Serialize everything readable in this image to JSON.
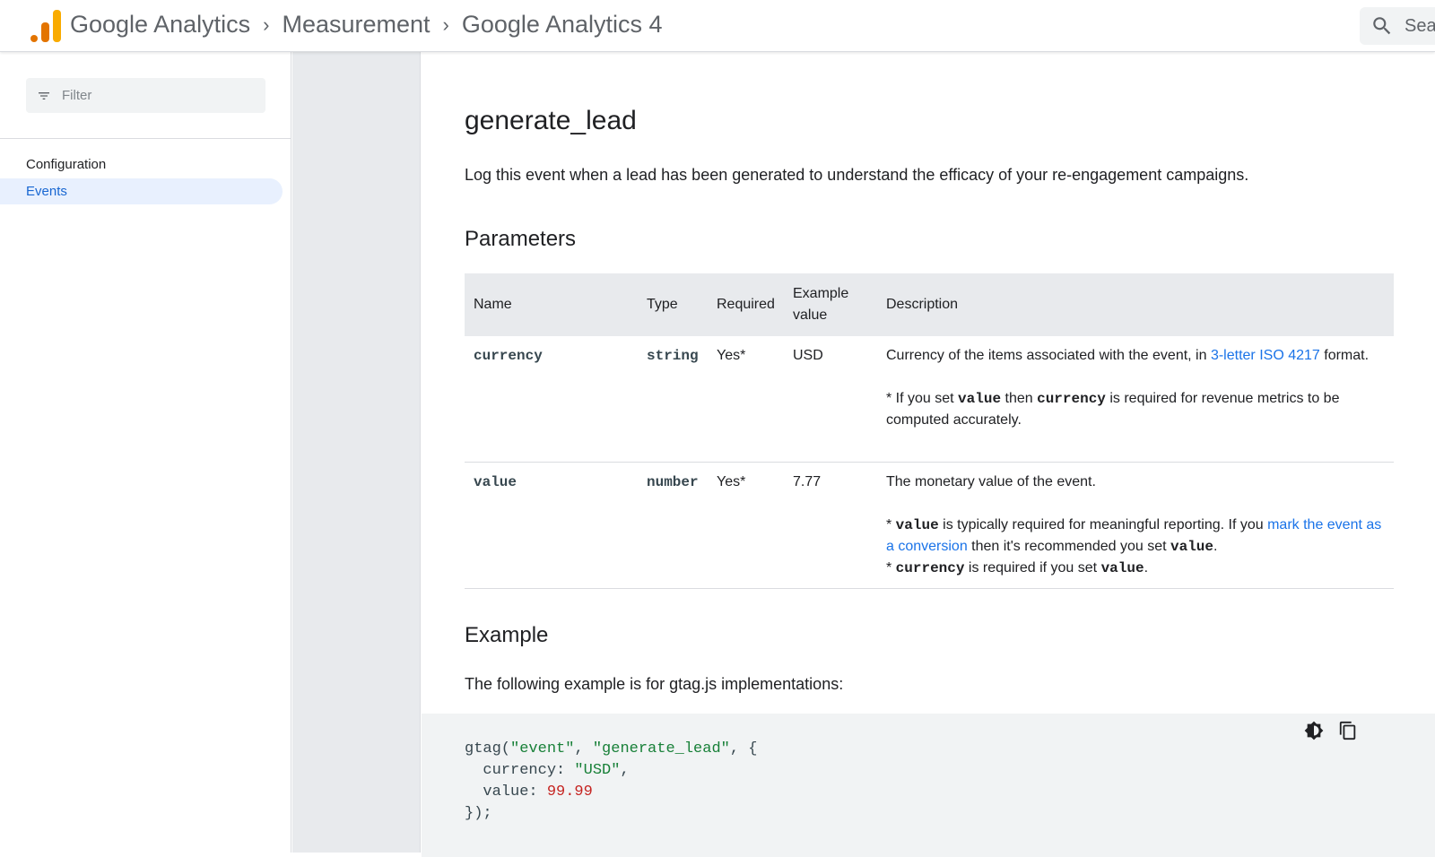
{
  "header": {
    "brand_google": "Google",
    "brand_analytics": "Analytics",
    "crumb1": "Measurement",
    "crumb2": "Google Analytics 4",
    "separator": ">",
    "search_placeholder": "Sear"
  },
  "sidebar": {
    "filter_placeholder": "Filter",
    "items": [
      {
        "label": "Configuration",
        "selected": false
      },
      {
        "label": "Events",
        "selected": true
      }
    ]
  },
  "main": {
    "title": "generate_lead",
    "intro": "Log this event when a lead has been generated to understand the efficacy of your re-engagement campaigns.",
    "params_heading": "Parameters",
    "table": {
      "headers": [
        "Name",
        "Type",
        "Required",
        "Example value",
        "Description"
      ],
      "header_example_line1": "Example",
      "header_example_line2": "value",
      "rows": [
        {
          "name": "currency",
          "type": "string",
          "required": "Yes*",
          "example": "USD",
          "desc_a": "Currency of the items associated with the event, in ",
          "desc_link": "3-letter ISO 4217",
          "desc_b": " format.",
          "note_prefix": "* If you set ",
          "note_code1": "value",
          "note_mid": " then ",
          "note_code2": "currency",
          "note_suffix": " is required for revenue metrics to be computed accurately."
        },
        {
          "name": "value",
          "type": "number",
          "required": "Yes*",
          "example": "7.77",
          "desc": "The monetary value of the event.",
          "note1_prefix": "* ",
          "note1_code": "value",
          "note1_mid": " is typically required for meaningful reporting. If you ",
          "note1_link": "mark the event as a conversion",
          "note1_after": " then it's recommended you set ",
          "note1_code2": "value",
          "note1_end": ".",
          "note2_prefix": "* ",
          "note2_code": "currency",
          "note2_mid": " is required if you set ",
          "note2_code2": "value",
          "note2_end": "."
        }
      ]
    },
    "example_heading": "Example",
    "example_text": "The following example is for gtag.js implementations:",
    "code": {
      "line1_fn": "gtag(",
      "line1_s1": "\"event\"",
      "line1_c1": ", ",
      "line1_s2": "\"generate_lead\"",
      "line1_end": ", {",
      "line2_key": "  currency: ",
      "line2_val": "\"USD\"",
      "line2_end": ",",
      "line3_key": "  value: ",
      "line3_val": "99.99",
      "line4": "});"
    },
    "icons": [
      "dark-mode-icon",
      "copy-icon"
    ]
  }
}
